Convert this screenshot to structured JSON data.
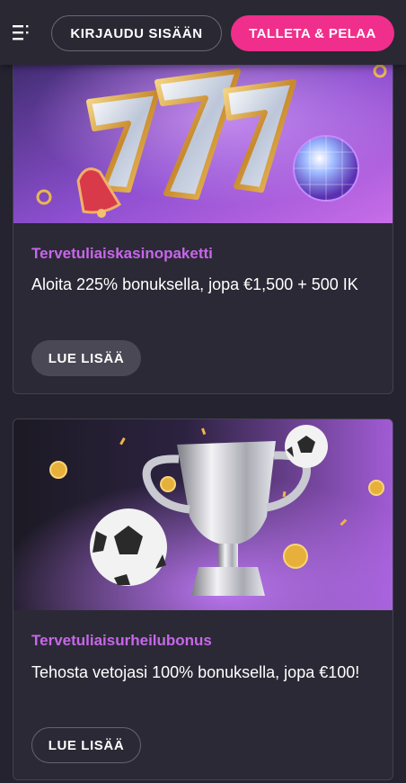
{
  "header": {
    "menu_icon": "menu-icon",
    "login_label": "KIRJAUDU SISÄÄN",
    "deposit_label": "TALLETA & PELAA",
    "deposit_color": "#ef2f8b"
  },
  "promotions": [
    {
      "image": "slot-777-bell-disco-ball-illustration",
      "title": "Tervetuliaiskasinopaketti",
      "description": "Aloita 225% bonuksella, jopa €1,500 + 500 IK",
      "button_label": "LUE LISÄÄ"
    },
    {
      "image": "trophy-soccer-balls-coins-illustration",
      "title": "Tervetuliaisurheilubonus",
      "description": "Tehosta vetojasi 100% bonuksella, jopa €100!",
      "button_label": "LUE LISÄÄ"
    }
  ],
  "colors": {
    "background": "#252330",
    "card": "#2b2935",
    "title_accent": "#c767ea"
  }
}
